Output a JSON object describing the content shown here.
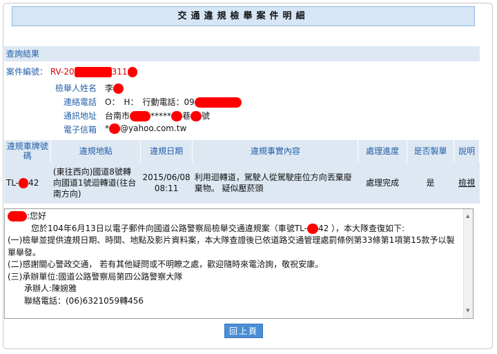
{
  "page_title": "交通違規檢舉案件明細",
  "section_title": "查詢結果",
  "case": {
    "id_label": "案件編號：",
    "id_prefix": "RV-20",
    "id_suffix": "311"
  },
  "reporter": {
    "name_label": "檢舉人姓名",
    "name_value": "李",
    "phone_label": "連絡電話",
    "phone_value": "O：　H：　行動電話：09",
    "address_label": "通訊地址",
    "address_prefix": "台南市",
    "address_mid": "*****",
    "address_mid2": "巷",
    "address_suffix": "號",
    "email_label": "電子信箱",
    "email_prefix": "*",
    "email_suffix": "@yahoo.com.tw"
  },
  "table": {
    "headers": [
      "違規車牌號碼",
      "違規地點",
      "違規日期",
      "違規事實內容",
      "處理進度",
      "是否製單",
      "說明"
    ],
    "row": {
      "plate_prefix": "TL-",
      "plate_suffix": "42",
      "location": "(東往西向)國道8號轉向國道1號迴轉道(往台南方向)",
      "date": "2015/06/08 08:11",
      "fact": "利用迴轉道，駕駛人從駕駛座位方向丟棄廢棄物。 疑似壓菸頭",
      "status": "處理完成",
      "ticketed": "是",
      "detail_link": "檢視"
    }
  },
  "reply": {
    "greeting": ":您好",
    "line1_a": "您於104年6月13日以電子郵件向國道公路警察局檢舉交通違規案（車號TL-",
    "line1_b": "42 ），本大隊查復如下:",
    "line2": "(一)檢舉並提供違規日期、時間、地點及影片資料案，本大隊查證後已依道路交通管理處罰條例第33條第1項第15款予以製單舉發。",
    "line3": "(二)感謝關心警政交通， 若有其他疑問或不明瞭之處，歡迎隨時來電洽詢，敬祝安康。",
    "line4": "(三)承辦單位:國道公路警察局第四公路警察大隊",
    "line5": "承辦人:陳婉雅",
    "line6": "聯絡電話：(06)6321059轉456"
  },
  "back_button": "回上頁"
}
